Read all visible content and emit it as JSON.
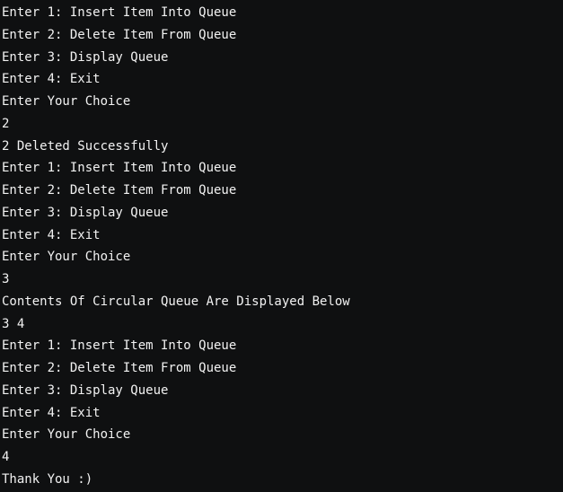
{
  "terminal": {
    "lines": [
      "Enter 1: Insert Item Into Queue",
      "Enter 2: Delete Item From Queue",
      "Enter 3: Display Queue",
      "Enter 4: Exit",
      "Enter Your Choice",
      "2",
      "2 Deleted Successfully",
      "Enter 1: Insert Item Into Queue",
      "Enter 2: Delete Item From Queue",
      "Enter 3: Display Queue",
      "Enter 4: Exit",
      "Enter Your Choice",
      "3",
      "Contents Of Circular Queue Are Displayed Below",
      "3 4",
      "Enter 1: Insert Item Into Queue",
      "Enter 2: Delete Item From Queue",
      "Enter 3: Display Queue",
      "Enter 4: Exit",
      "Enter Your Choice",
      "4",
      "Thank You :)"
    ],
    "colors": {
      "background": "#0f1011",
      "text": "#f2f2f2"
    }
  }
}
